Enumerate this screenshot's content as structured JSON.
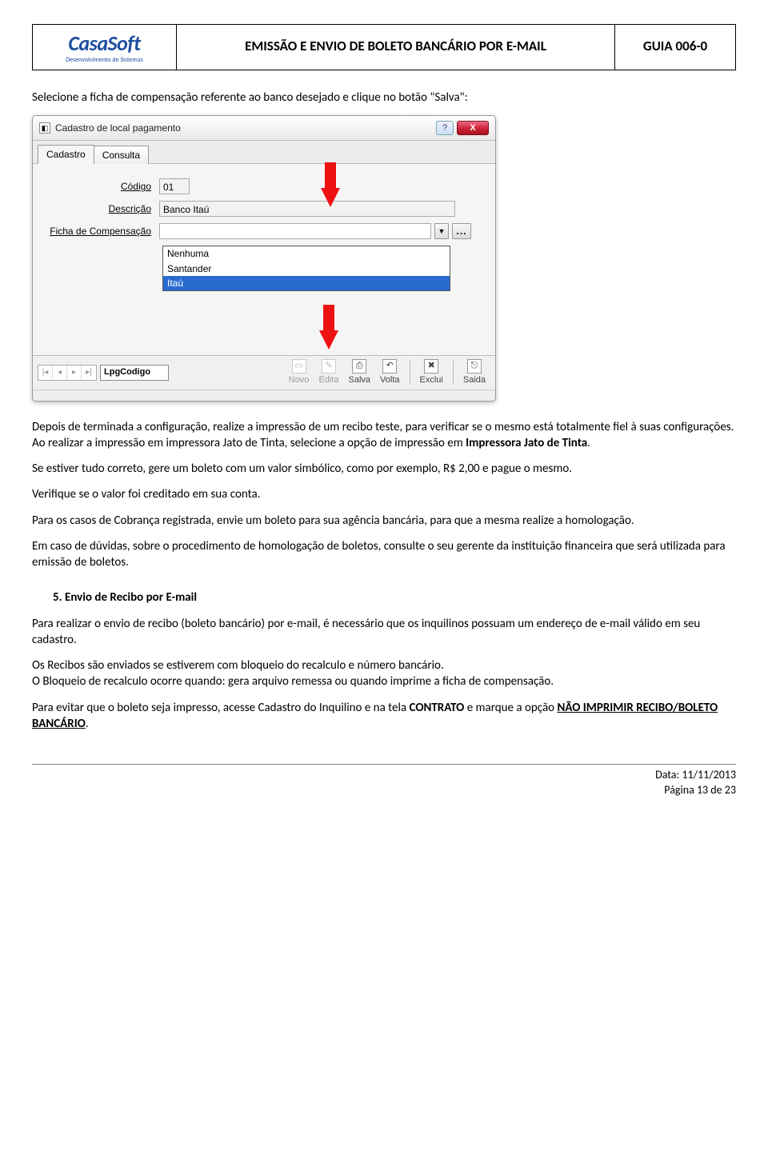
{
  "header": {
    "logo_main": "CasaSoft",
    "logo_sub": "Desenvolvimento de Sistemas",
    "title": "EMISSÃO E ENVIO DE BOLETO BANCÁRIO POR E-MAIL",
    "guide": "GUIA 006-0"
  },
  "intro": "Selecione a ficha de compensação referente ao banco desejado e clique no botão \"Salva\":",
  "app": {
    "window_title": "Cadastro de local pagamento",
    "help_label": "?",
    "close_label": "X",
    "tabs": {
      "active": "Cadastro",
      "other": "Consulta"
    },
    "fields": {
      "codigo_label": "Código",
      "codigo_value": "01",
      "descricao_label": "Descrição",
      "descricao_value": "Banco Itaú",
      "ficha_label": "Ficha de Compensação",
      "ficha_value": "",
      "dropdown_options": [
        "Nenhuma",
        "Santander",
        "Itaú"
      ],
      "dropdown_selected_index": 2,
      "dots": "..."
    },
    "nav_lpg": "LpgCodigo",
    "toolbar": {
      "novo": "Novo",
      "edita": "Edita",
      "salva": "Salva",
      "volta": "Volta",
      "exclui": "Exclui",
      "saida": "Saida"
    }
  },
  "body_paras": {
    "p1a": "Depois de terminada a configuração, realize a impressão de um recibo teste, para verificar se o mesmo está totalmente fiel à suas configurações.",
    "p1b_pre": "Ao realizar a impressão em impressora Jato de Tinta, selecione a opção de impressão em ",
    "p1b_bold": "Impressora Jato de Tinta",
    "p1b_post": ".",
    "p2": "Se estiver tudo correto, gere um boleto com um valor simbólico, como por exemplo, R$ 2,00 e pague o mesmo.",
    "p3": "Verifique se o valor foi creditado em sua conta.",
    "p4": "Para os casos de Cobrança registrada, envie um boleto para sua agência bancária, para que a mesma realize a homologação.",
    "p5": "Em caso de dúvidas, sobre o procedimento de homologação de boletos, consulte o seu gerente da instituição financeira que será utilizada para emissão de boletos."
  },
  "section5": {
    "heading": "5.   Envio de Recibo por E-mail",
    "p1": "Para realizar o envio de recibo (boleto bancário) por e-mail, é necessário que os inquilinos possuam um endereço de e-mail válido em seu cadastro.",
    "p2": "Os Recibos são enviados se estiverem com bloqueio do recalculo e número bancário.",
    "p3": "O Bloqueio de recalculo ocorre quando: gera arquivo remessa ou quando imprime a ficha de compensação.",
    "p4_pre": "Para evitar que o boleto seja impresso, acesse Cadastro do Inquilino e na tela ",
    "p4_b1": "CONTRATO",
    "p4_mid": " e marque a opção ",
    "p4_b2": "NÃO IMPRIMIR RECIBO/BOLETO BANCÁRIO",
    "p4_post": "."
  },
  "footer": {
    "date_label": "Data: ",
    "date_value": "11/11/2013",
    "page_label": "Página ",
    "page_value": "13 de 23"
  }
}
